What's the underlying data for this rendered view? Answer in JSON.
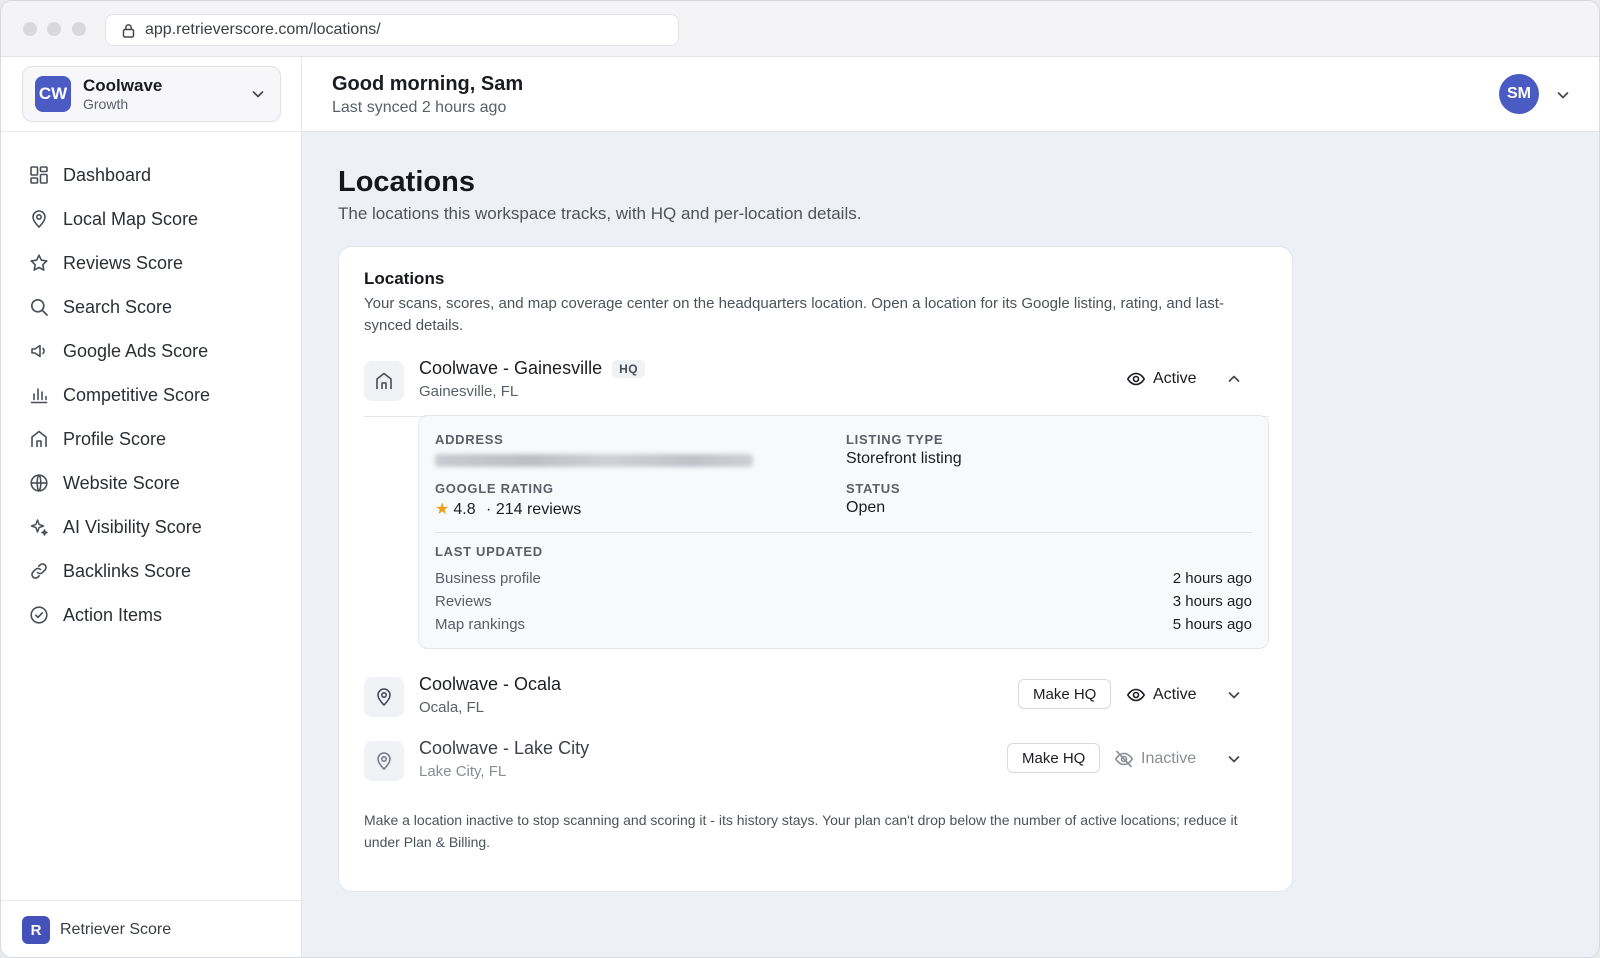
{
  "browser": {
    "url": "app.retrieverscore.com/locations/"
  },
  "workspace": {
    "initials": "CW",
    "name": "Coolwave",
    "plan": "Growth"
  },
  "sidebar": {
    "items": [
      {
        "label": "Dashboard",
        "icon": "dashboard-grid-icon"
      },
      {
        "label": "Local Map Score",
        "icon": "map-pin-icon"
      },
      {
        "label": "Reviews Score",
        "icon": "star-icon"
      },
      {
        "label": "Search Score",
        "icon": "search-icon"
      },
      {
        "label": "Google Ads Score",
        "icon": "megaphone-icon"
      },
      {
        "label": "Competitive Score",
        "icon": "bar-chart-icon"
      },
      {
        "label": "Profile Score",
        "icon": "storefront-icon"
      },
      {
        "label": "Website Score",
        "icon": "globe-icon"
      },
      {
        "label": "AI Visibility Score",
        "icon": "sparkle-icon"
      },
      {
        "label": "Backlinks Score",
        "icon": "link-icon"
      },
      {
        "label": "Action Items",
        "icon": "check-circle-icon"
      }
    ],
    "brand": {
      "initial": "R",
      "name": "Retriever Score"
    }
  },
  "header": {
    "greeting": "Good morning, Sam",
    "synced": "Last synced 2 hours ago",
    "avatar_initials": "SM"
  },
  "page": {
    "title": "Locations",
    "subtitle": "The locations this workspace tracks, with HQ and per-location details."
  },
  "card": {
    "title": "Locations",
    "description": "Your scans, scores, and map coverage center on the headquarters location. Open a location for its Google listing, rating, and last-synced details.",
    "footer": "Make a location inactive to stop scanning and scoring it - its history stays. Your plan can't drop below the number of active locations; reduce it under Plan & Billing."
  },
  "locations": [
    {
      "name": "Coolwave - Gainesville",
      "city": "Gainesville, FL",
      "badge": "HQ",
      "status": "Active",
      "expanded": true
    },
    {
      "name": "Coolwave - Ocala",
      "city": "Ocala, FL",
      "make_hq_label": "Make HQ",
      "status": "Active",
      "expanded": false
    },
    {
      "name": "Coolwave - Lake City",
      "city": "Lake City, FL",
      "make_hq_label": "Make HQ",
      "status": "Inactive",
      "expanded": false
    }
  ],
  "details": {
    "address_label": "ADDRESS",
    "listing_type_label": "LISTING TYPE",
    "listing_type": "Storefront listing",
    "rating_label": "GOOGLE RATING",
    "rating": "4.8",
    "reviews": "· 214 reviews",
    "status_label": "STATUS",
    "status": "Open",
    "last_updated_label": "LAST UPDATED",
    "updates": [
      {
        "item": "Business profile",
        "time": "2 hours ago"
      },
      {
        "item": "Reviews",
        "time": "3 hours ago"
      },
      {
        "item": "Map rankings",
        "time": "5 hours ago"
      }
    ]
  },
  "colors": {
    "accent": "#4b5bc4",
    "star": "#e8a21a",
    "background": "#eef0f7"
  }
}
